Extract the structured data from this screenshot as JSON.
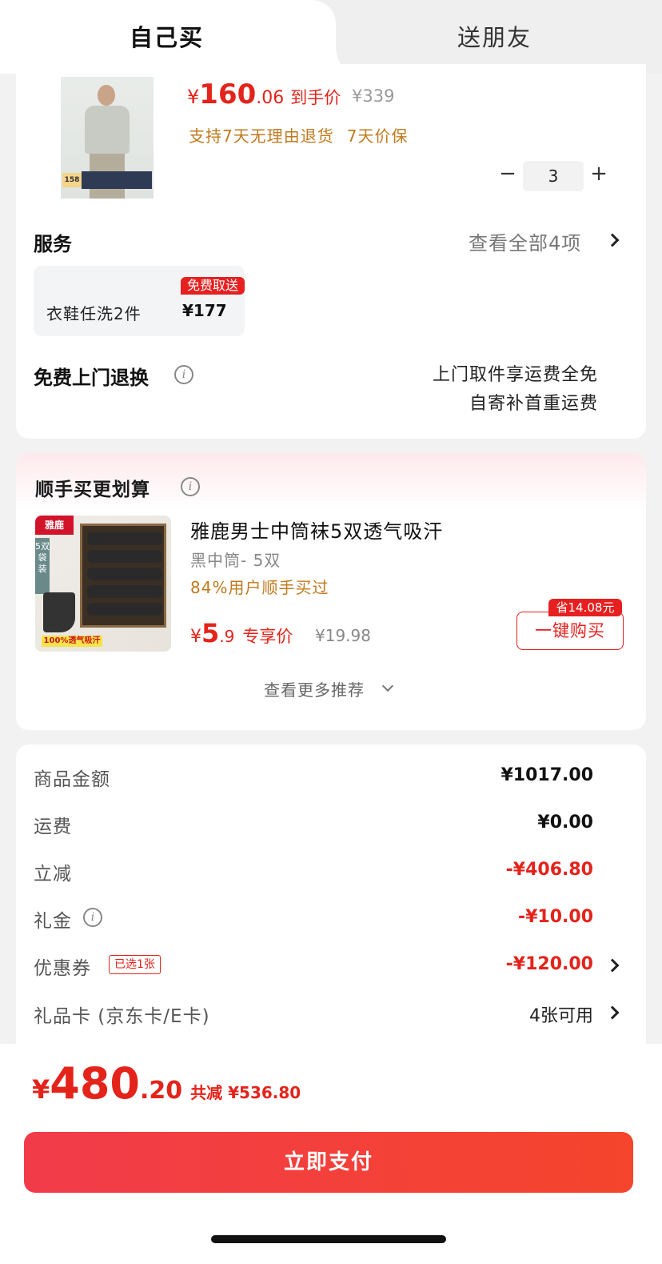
{
  "tabs": {
    "self": "自己买",
    "gift": "送朋友"
  },
  "product": {
    "price_yen": "¥",
    "price_int": "160",
    "price_dec": ".06",
    "price_label": "到手价",
    "original_price": "¥339",
    "support_1": "支持7天无理由退货",
    "support_2": "7天价保",
    "quantity": "3",
    "minus": "−",
    "plus": "+",
    "image_tag": "158"
  },
  "service": {
    "title": "服务",
    "view_all": "查看全部4项",
    "item_name": "衣鞋任洗2件",
    "item_price": "¥177",
    "item_badge": "免费取送"
  },
  "return_exchange": {
    "title": "免费上门退换",
    "line1": "上门取件享运费全免",
    "line2": "自寄补首重运费"
  },
  "recommend": {
    "title": "顺手买更划算",
    "name": "雅鹿男士中筒袜5双透气吸汗",
    "spec": "黑中筒- 5双",
    "bought": "84%用户顺手买过",
    "price_yen": "¥",
    "price_int": "5",
    "price_dec": ".9",
    "price_label": "专享价",
    "original_price": "¥19.98",
    "buy_button": "一键购买",
    "save_badge": "省14.08元",
    "more": "查看更多推荐",
    "image_brand": "雅鹿",
    "image_side": "5双袋装",
    "image_caption": "100%透气吸汗"
  },
  "summary": {
    "rows": [
      {
        "label": "商品金额",
        "value": "¥1017.00"
      },
      {
        "label": "运费",
        "value": "¥0.00"
      },
      {
        "label": "立减",
        "value": "-¥406.80"
      },
      {
        "label": "礼金",
        "value": "-¥10.00"
      },
      {
        "label": "优惠券",
        "value": "-¥120.00",
        "tag": "已选1张"
      },
      {
        "label": "礼品卡 (京东卡/E卡)",
        "value": "4张可用"
      }
    ]
  },
  "footer": {
    "total_yen": "¥",
    "total_int": "480",
    "total_dec": ".20",
    "total_saved": "共减 ¥536.80",
    "pay_button": "立即支付"
  },
  "colors": {
    "accent_red": "#e4231a",
    "gold_text": "#c07a1e",
    "pay_gradient_start": "#f23b4a",
    "pay_gradient_end": "#f5452c"
  }
}
